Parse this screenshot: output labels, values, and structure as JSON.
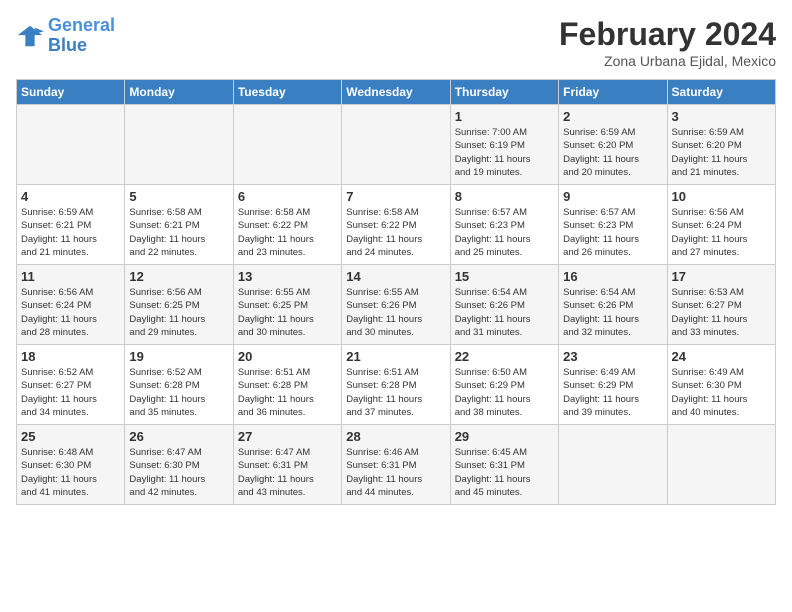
{
  "logo": {
    "line1": "General",
    "line2": "Blue"
  },
  "title": "February 2024",
  "subtitle": "Zona Urbana Ejidal, Mexico",
  "days_header": [
    "Sunday",
    "Monday",
    "Tuesday",
    "Wednesday",
    "Thursday",
    "Friday",
    "Saturday"
  ],
  "weeks": [
    [
      {
        "day": "",
        "info": ""
      },
      {
        "day": "",
        "info": ""
      },
      {
        "day": "",
        "info": ""
      },
      {
        "day": "",
        "info": ""
      },
      {
        "day": "1",
        "info": "Sunrise: 7:00 AM\nSunset: 6:19 PM\nDaylight: 11 hours\nand 19 minutes."
      },
      {
        "day": "2",
        "info": "Sunrise: 6:59 AM\nSunset: 6:20 PM\nDaylight: 11 hours\nand 20 minutes."
      },
      {
        "day": "3",
        "info": "Sunrise: 6:59 AM\nSunset: 6:20 PM\nDaylight: 11 hours\nand 21 minutes."
      }
    ],
    [
      {
        "day": "4",
        "info": "Sunrise: 6:59 AM\nSunset: 6:21 PM\nDaylight: 11 hours\nand 21 minutes."
      },
      {
        "day": "5",
        "info": "Sunrise: 6:58 AM\nSunset: 6:21 PM\nDaylight: 11 hours\nand 22 minutes."
      },
      {
        "day": "6",
        "info": "Sunrise: 6:58 AM\nSunset: 6:22 PM\nDaylight: 11 hours\nand 23 minutes."
      },
      {
        "day": "7",
        "info": "Sunrise: 6:58 AM\nSunset: 6:22 PM\nDaylight: 11 hours\nand 24 minutes."
      },
      {
        "day": "8",
        "info": "Sunrise: 6:57 AM\nSunset: 6:23 PM\nDaylight: 11 hours\nand 25 minutes."
      },
      {
        "day": "9",
        "info": "Sunrise: 6:57 AM\nSunset: 6:23 PM\nDaylight: 11 hours\nand 26 minutes."
      },
      {
        "day": "10",
        "info": "Sunrise: 6:56 AM\nSunset: 6:24 PM\nDaylight: 11 hours\nand 27 minutes."
      }
    ],
    [
      {
        "day": "11",
        "info": "Sunrise: 6:56 AM\nSunset: 6:24 PM\nDaylight: 11 hours\nand 28 minutes."
      },
      {
        "day": "12",
        "info": "Sunrise: 6:56 AM\nSunset: 6:25 PM\nDaylight: 11 hours\nand 29 minutes."
      },
      {
        "day": "13",
        "info": "Sunrise: 6:55 AM\nSunset: 6:25 PM\nDaylight: 11 hours\nand 30 minutes."
      },
      {
        "day": "14",
        "info": "Sunrise: 6:55 AM\nSunset: 6:26 PM\nDaylight: 11 hours\nand 30 minutes."
      },
      {
        "day": "15",
        "info": "Sunrise: 6:54 AM\nSunset: 6:26 PM\nDaylight: 11 hours\nand 31 minutes."
      },
      {
        "day": "16",
        "info": "Sunrise: 6:54 AM\nSunset: 6:26 PM\nDaylight: 11 hours\nand 32 minutes."
      },
      {
        "day": "17",
        "info": "Sunrise: 6:53 AM\nSunset: 6:27 PM\nDaylight: 11 hours\nand 33 minutes."
      }
    ],
    [
      {
        "day": "18",
        "info": "Sunrise: 6:52 AM\nSunset: 6:27 PM\nDaylight: 11 hours\nand 34 minutes."
      },
      {
        "day": "19",
        "info": "Sunrise: 6:52 AM\nSunset: 6:28 PM\nDaylight: 11 hours\nand 35 minutes."
      },
      {
        "day": "20",
        "info": "Sunrise: 6:51 AM\nSunset: 6:28 PM\nDaylight: 11 hours\nand 36 minutes."
      },
      {
        "day": "21",
        "info": "Sunrise: 6:51 AM\nSunset: 6:28 PM\nDaylight: 11 hours\nand 37 minutes."
      },
      {
        "day": "22",
        "info": "Sunrise: 6:50 AM\nSunset: 6:29 PM\nDaylight: 11 hours\nand 38 minutes."
      },
      {
        "day": "23",
        "info": "Sunrise: 6:49 AM\nSunset: 6:29 PM\nDaylight: 11 hours\nand 39 minutes."
      },
      {
        "day": "24",
        "info": "Sunrise: 6:49 AM\nSunset: 6:30 PM\nDaylight: 11 hours\nand 40 minutes."
      }
    ],
    [
      {
        "day": "25",
        "info": "Sunrise: 6:48 AM\nSunset: 6:30 PM\nDaylight: 11 hours\nand 41 minutes."
      },
      {
        "day": "26",
        "info": "Sunrise: 6:47 AM\nSunset: 6:30 PM\nDaylight: 11 hours\nand 42 minutes."
      },
      {
        "day": "27",
        "info": "Sunrise: 6:47 AM\nSunset: 6:31 PM\nDaylight: 11 hours\nand 43 minutes."
      },
      {
        "day": "28",
        "info": "Sunrise: 6:46 AM\nSunset: 6:31 PM\nDaylight: 11 hours\nand 44 minutes."
      },
      {
        "day": "29",
        "info": "Sunrise: 6:45 AM\nSunset: 6:31 PM\nDaylight: 11 hours\nand 45 minutes."
      },
      {
        "day": "",
        "info": ""
      },
      {
        "day": "",
        "info": ""
      }
    ]
  ]
}
